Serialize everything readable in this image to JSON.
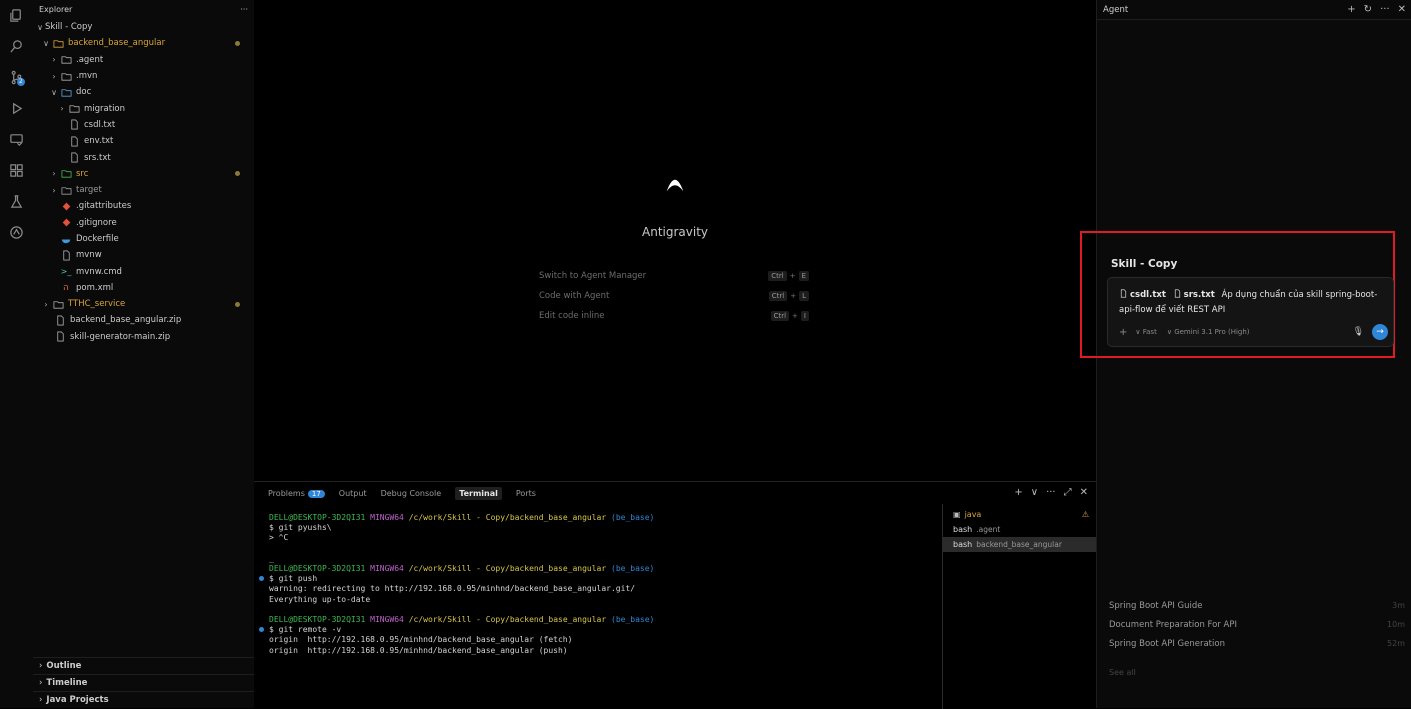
{
  "activity_badge": "2",
  "explorer": {
    "title": "Explorer",
    "more": "···",
    "items": [
      {
        "label": "Skill - Copy"
      },
      {
        "label": "backend_base_angular"
      },
      {
        "label": ".agent"
      },
      {
        "label": ".mvn"
      },
      {
        "label": "doc"
      },
      {
        "label": "migration"
      },
      {
        "label": "csdl.txt"
      },
      {
        "label": "env.txt"
      },
      {
        "label": "srs.txt"
      },
      {
        "label": "src"
      },
      {
        "label": "target"
      },
      {
        "label": ".gitattributes"
      },
      {
        "label": ".gitignore"
      },
      {
        "label": "Dockerfile"
      },
      {
        "label": "mvnw"
      },
      {
        "label": "mvnw.cmd"
      },
      {
        "label": "pom.xml"
      },
      {
        "label": "TTHC_service"
      },
      {
        "label": "backend_base_angular.zip"
      },
      {
        "label": "skill-generator-main.zip"
      }
    ],
    "bottom_sections": [
      "Outline",
      "Timeline",
      "Java Projects"
    ]
  },
  "welcome": {
    "app_name": "Antigravity",
    "shortcuts": [
      {
        "label": "Switch to Agent Manager",
        "mod": "Ctrl",
        "key": "E"
      },
      {
        "label": "Code with Agent",
        "mod": "Ctrl",
        "key": "L"
      },
      {
        "label": "Edit code inline",
        "mod": "Ctrl",
        "key": "I"
      }
    ]
  },
  "panel": {
    "tabs": {
      "problems": "Problems",
      "problems_count": "17",
      "output": "Output",
      "debug": "Debug Console",
      "terminal": "Terminal",
      "ports": "Ports"
    },
    "prompt_user": "DELL@DESKTOP-3D2QI31",
    "prompt_env": "MINGW64",
    "prompt_path": "/c/work/Skill - Copy/backend_base_angular",
    "prompt_branch": "(be_base)",
    "lines": {
      "c1": "$ git pyushs\\",
      "c1b": "> ^C",
      "cursor": "_",
      "c2": "$ git push",
      "o2a": "warning: redirecting to http://192.168.0.95/minhnd/backend_base_angular.git/",
      "o2b": "Everything up-to-date",
      "c3": "$ git remote -v",
      "o3a": "origin  http://192.168.0.95/minhnd/backend_base_angular (fetch)",
      "o3b": "origin  http://192.168.0.95/minhnd/backend_base_angular (push)"
    },
    "terminals": [
      {
        "name": "java",
        "sub": ""
      },
      {
        "name": "bash",
        "sub": ".agent"
      },
      {
        "name": "bash",
        "sub": "backend_base_angular"
      }
    ]
  },
  "agent": {
    "title": "Agent",
    "workspace": "Skill - Copy",
    "ctx1": "csdl.txt",
    "ctx2": "srs.txt",
    "prompt": "Áp dụng chuẩn của skill spring-boot-api-flow để viết REST API",
    "mode": "Fast",
    "model": "Gemini 3.1 Pro (High)",
    "recent": [
      {
        "title": "Spring Boot API Guide",
        "time": "3m"
      },
      {
        "title": "Document Preparation For API",
        "time": "10m"
      },
      {
        "title": "Spring Boot API Generation",
        "time": "52m"
      }
    ],
    "see_all": "See all"
  }
}
